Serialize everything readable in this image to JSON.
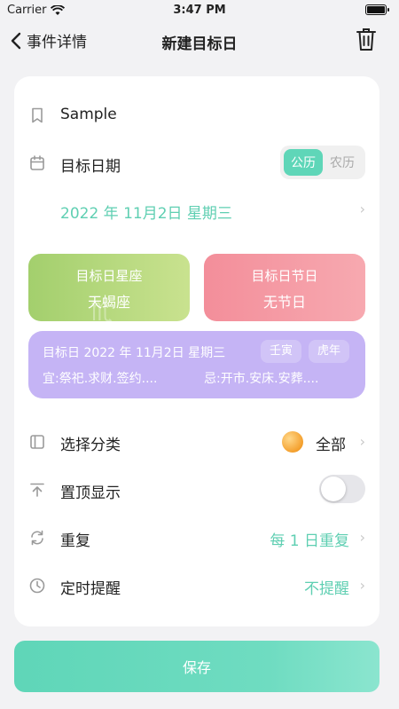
{
  "status_bar": {
    "carrier": "Carrier",
    "time": "3:47 PM"
  },
  "nav": {
    "back_label": "事件详情",
    "title": "新建目标日"
  },
  "form": {
    "name_value": "Sample",
    "date_label": "目标日期",
    "calendar_toggle": {
      "solar": "公历",
      "lunar": "农历",
      "selected": "公历"
    },
    "selected_date": "2022 年 11月2日  星期三",
    "zodiac_tile": {
      "title": "目标日星座",
      "value": "天蝎座"
    },
    "holiday_tile": {
      "title": "目标日节日",
      "value": "无节日"
    },
    "lunar_card": {
      "heading": "目标日 2022 年 11月2日  星期三",
      "tag_ganzhi": "壬寅",
      "tag_zodiac": "虎年",
      "yi": "宜:祭祀.求财.签约....",
      "ji": "忌:开市.安床.安葬...."
    },
    "category": {
      "label": "选择分类",
      "value": "全部"
    },
    "pin_top": {
      "label": "置顶显示",
      "enabled": false
    },
    "repeat": {
      "label": "重复",
      "value": "每 1 日重复"
    },
    "reminder": {
      "label": "定时提醒",
      "value": "不提醒"
    }
  },
  "save_label": "保存",
  "colors": {
    "accent": "#5fd6b8",
    "purple": "#c5b4f5",
    "green": "#a3cf6d",
    "red": "#f38e9a"
  }
}
